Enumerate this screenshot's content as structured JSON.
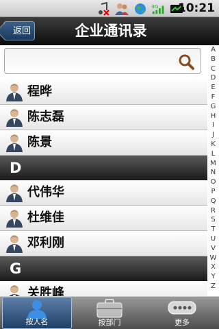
{
  "status": {
    "time": "10:21"
  },
  "header": {
    "back_label": "返回",
    "title": "企业通讯录"
  },
  "search": {
    "placeholder": ""
  },
  "contacts": [
    {
      "type": "row",
      "name": "程晔"
    },
    {
      "type": "row",
      "name": "陈志磊"
    },
    {
      "type": "row",
      "name": "陈景"
    },
    {
      "type": "header",
      "letter": "D"
    },
    {
      "type": "row",
      "name": "代伟华"
    },
    {
      "type": "row",
      "name": "杜维佳"
    },
    {
      "type": "row",
      "name": "邓利刚"
    },
    {
      "type": "header",
      "letter": "G"
    },
    {
      "type": "row",
      "name": "关胜峰"
    }
  ],
  "alphabet": [
    "A",
    "B",
    "C",
    "D",
    "E",
    "F",
    "G",
    "H",
    "I",
    "J",
    "K",
    "L",
    "M",
    "N",
    "O",
    "P",
    "Q",
    "R",
    "S",
    "T",
    "U",
    "V",
    "W",
    "X",
    "Y",
    "Z"
  ],
  "tabs": [
    {
      "label": "按人名",
      "icon": "person-icon",
      "active": true
    },
    {
      "label": "按部门",
      "icon": "briefcase-icon",
      "active": false
    },
    {
      "label": "更多",
      "icon": "more-icon",
      "active": false
    }
  ]
}
